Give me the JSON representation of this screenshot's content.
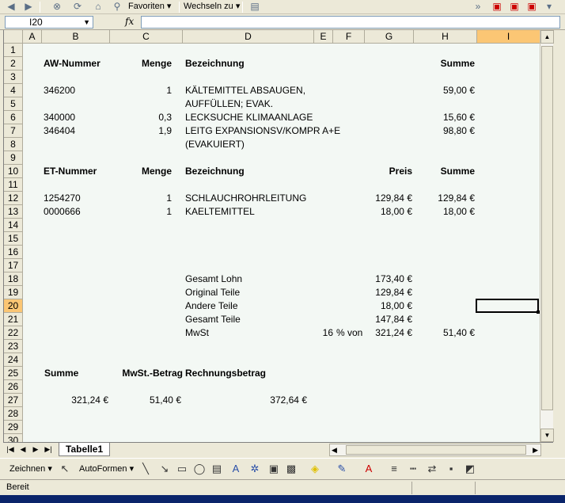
{
  "toolbar": {
    "favoriten_label": "Favoriten",
    "wechseln_label": "Wechseln zu"
  },
  "formula": {
    "namebox_value": "I20",
    "fx_label": "fx"
  },
  "columns": [
    "A",
    "B",
    "C",
    "D",
    "E",
    "F",
    "G",
    "H",
    "I"
  ],
  "selected_column": "I",
  "rows": [
    "1",
    "2",
    "3",
    "4",
    "5",
    "6",
    "7",
    "8",
    "9",
    "10",
    "11",
    "12",
    "13",
    "14",
    "15",
    "16",
    "17",
    "18",
    "19",
    "20",
    "21",
    "22",
    "23",
    "24",
    "25",
    "26",
    "27",
    "28",
    "29",
    "30"
  ],
  "selected_row": "20",
  "sheet": {
    "aw_header": {
      "nummer": "AW-Nummer",
      "menge": "Menge",
      "bezeichnung": "Bezeichnung",
      "summe": "Summe"
    },
    "aw_items": [
      {
        "nummer": "346200",
        "menge": "1",
        "bezeichnung": "KÄLTEMITTEL ABSAUGEN,",
        "bezeichnung2": "AUFFÜLLEN; EVAK.",
        "summe": "59,00 €"
      },
      {
        "nummer": "340000",
        "menge": "0,3",
        "bezeichnung": "LECKSUCHE KLIMAANLAGE",
        "summe": "15,60 €"
      },
      {
        "nummer": "346404",
        "menge": "1,9",
        "bezeichnung": "LEITG EXPANSIONSV/KOMPR A+E",
        "bezeichnung2": "(EVAKUIERT)",
        "summe": "98,80 €"
      }
    ],
    "et_header": {
      "nummer": "ET-Nummer",
      "menge": "Menge",
      "bezeichnung": "Bezeichnung",
      "preis": "Preis",
      "summe": "Summe"
    },
    "et_items": [
      {
        "nummer": "1254270",
        "menge": "1",
        "bezeichnung": "SCHLAUCHROHRLEITUNG",
        "preis": "129,84 €",
        "summe": "129,84 €"
      },
      {
        "nummer": "0000666",
        "menge": "1",
        "bezeichnung": "KAELTEMITTEL",
        "preis": "18,00 €",
        "summe": "18,00 €"
      }
    ],
    "totals": {
      "gesamt_lohn_label": "Gesamt Lohn",
      "gesamt_lohn": "173,40 €",
      "original_teile_label": "Original Teile",
      "original_teile": "129,84 €",
      "andere_teile_label": "Andere Teile",
      "andere_teile": "18,00 €",
      "gesamt_teile_label": "Gesamt Teile",
      "gesamt_teile": "147,84 €",
      "mwst_label": "MwSt",
      "mwst_rate": "16",
      "mwst_von": "% von",
      "mwst_basis": "321,24 €",
      "mwst_summe": "51,40 €"
    },
    "final_header": {
      "summe": "Summe",
      "mwst_betrag": "MwSt.-Betrag",
      "rechnungsbetrag": "Rechnungsbetrag"
    },
    "final_values": {
      "summe": "321,24 €",
      "mwst_betrag": "51,40 €",
      "rechnungsbetrag": "372,64 €"
    }
  },
  "sheet_tab": "Tabelle1",
  "drawing": {
    "zeichnen_label": "Zeichnen",
    "autoformen_label": "AutoFormen"
  },
  "status": "Bereit",
  "colors": {
    "grid_bg": "#f3f8f4",
    "selected_header": "#fbc674",
    "chrome": "#ece9d8"
  }
}
